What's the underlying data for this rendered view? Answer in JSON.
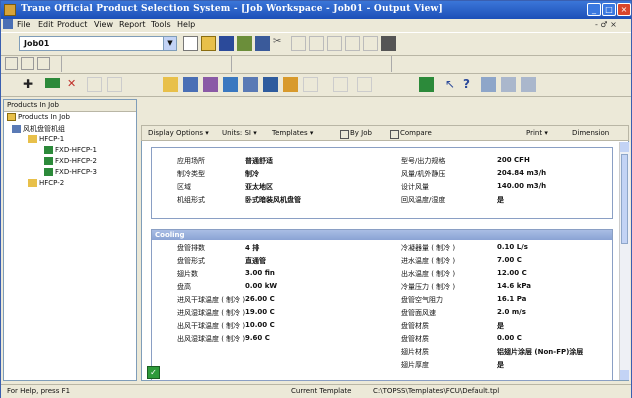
{
  "window": {
    "title": "Trane Official Product Selection System - [Job Workspace - Job01 - Output View]",
    "buttons": [
      "_",
      "□",
      "×"
    ]
  },
  "menu": {
    "items": [
      "File",
      "Edit",
      "Product",
      "View",
      "Report",
      "Tools",
      "Help"
    ],
    "mdi_controls": "- ♂ ×"
  },
  "toolbar": {
    "job_combo": "Job01"
  },
  "tree": {
    "header": "Products In Job",
    "root": "Products In Job",
    "nodes": [
      {
        "label": "风机盘管机组",
        "level": 1
      },
      {
        "label": "HFCP-1",
        "level": 2
      },
      {
        "label": "FXD-HFCP-1",
        "level": 3
      },
      {
        "label": "FXD-HFCP-2",
        "level": 3
      },
      {
        "label": "FXD-HFCP-3",
        "level": 3
      },
      {
        "label": "HFCP-2",
        "level": 2
      }
    ]
  },
  "viewbar": {
    "display_options": "Display Options ▾",
    "units": "Units: SI ▾",
    "templates": "Templates ▾",
    "by_job": "By Job",
    "compare": "Compare",
    "print": "Print ▾",
    "dimensions": "Dimension"
  },
  "general": {
    "rows": [
      {
        "label": "应用场所",
        "value": "普通舒适",
        "label2": "型号/出力规格",
        "value2": "200 CFH"
      },
      {
        "label": "制冷类型",
        "value": "制冷",
        "label2": "风量/机外静压",
        "value2": "204.84 m3/h"
      },
      {
        "label": "区域",
        "value": "亚太地区",
        "label2": "设计风量",
        "value2": "140.00 m3/h"
      },
      {
        "label": "机组形式",
        "value": "卧式暗装风机盘管",
        "label2": "回风温度/湿度",
        "value2": "是"
      }
    ]
  },
  "cooling": {
    "title": "Cooling",
    "rows": [
      {
        "label": "盘管排数",
        "value": "4 排",
        "label2": "冷凝器量 ( 制冷 )",
        "value2": "0.10 L/s"
      },
      {
        "label": "盘管形式",
        "value": "直通管",
        "label2": "进水温度 ( 制冷 )",
        "value2": "7.00 C"
      },
      {
        "label": "翅片数",
        "value": "3.00 fin",
        "label2": "出水温度 ( 制冷 )",
        "value2": "12.00 C"
      },
      {
        "label": "盘高",
        "value": "0.00 kW",
        "label2": "冷量压力 ( 制冷 )",
        "value2": "14.6 kPa"
      },
      {
        "label": "进风干球温度 ( 制冷 )",
        "value": "26.00 C",
        "label2": "盘管空气阻力",
        "value2": "16.1 Pa"
      },
      {
        "label": "进风湿球温度 ( 制冷 )",
        "value": "19.00 C",
        "label2": "盘管面风速",
        "value2": "2.0 m/s"
      },
      {
        "label": "出风干球温度 ( 制冷 )",
        "value": "10.00 C",
        "label2": "盘管材质",
        "value2": "是"
      },
      {
        "label": "出风湿球温度 ( 制冷 )",
        "value": "9.60 C",
        "label2": "盘管材质",
        "value2": "0.00 C"
      },
      {
        "label": "",
        "value": "",
        "label2": "翅片材质",
        "value2": "铝翅片涂层 (Non-FP)涂层"
      },
      {
        "label": "",
        "value": "",
        "label2": "翅片厚度",
        "value2": "是"
      }
    ]
  },
  "status": {
    "left": "For Help, press F1",
    "template": "Current Template",
    "path": "C:\\TOPSS\\Templates\\FCU\\Default.tpl"
  },
  "colors": {
    "title_bar": "#1c4fb8",
    "section_header": "#8aa3d4",
    "window_bg": "#ece9d8"
  }
}
